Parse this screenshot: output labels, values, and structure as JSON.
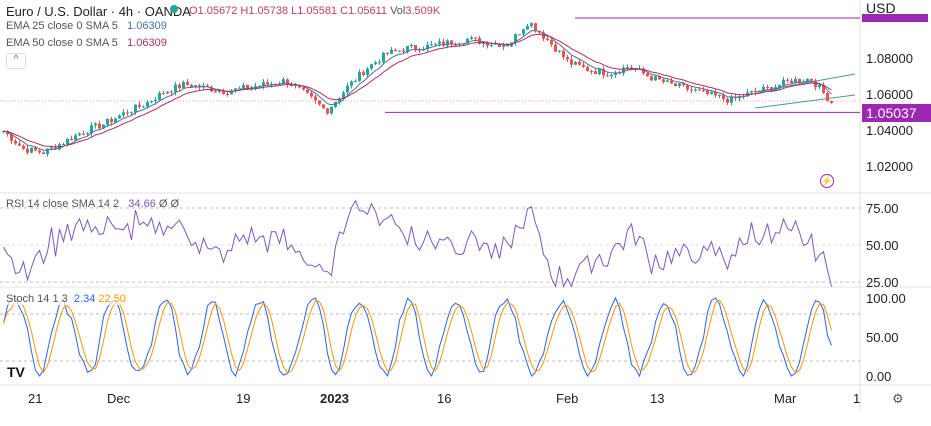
{
  "header": {
    "symbol": "Euro / U.S. Dollar · 4h · OANDA",
    "open": "O1.05672",
    "high": "H1.05738",
    "low": "L1.05581",
    "close": "C1.05611",
    "vol_label": "Vol",
    "vol": "3.509K"
  },
  "indicators": {
    "ema25_label": "EMA 25 close 0 SMA 5",
    "ema25_value": "1.06309",
    "ema50_label": "EMA 50 close 0 SMA 5",
    "ema50_value": "1.06309",
    "collapse": "^"
  },
  "price_axis": {
    "currency": "USD",
    "ticks": [
      "1.08000",
      "1.06000",
      "1.04000",
      "1.02000"
    ],
    "current_price": "1.05037"
  },
  "rsi": {
    "label": "RSI 14 close SMA 14 2",
    "value": "34.66",
    "extra": "Ø Ø",
    "ticks": [
      "75.00",
      "50.00",
      "25.00"
    ]
  },
  "stoch": {
    "label": "Stoch 14 1 3",
    "k": "2.34",
    "d": "22.50",
    "ticks": [
      "100.00",
      "50.00",
      "0.00"
    ]
  },
  "time_axis": [
    "21",
    "Dec",
    "19",
    "2023",
    "16",
    "Feb",
    "13",
    "Mar",
    "1"
  ],
  "colors": {
    "up": "#26a69a",
    "down": "#ef5350",
    "accent": "#9c27b0",
    "ema25": "#4a6fa5",
    "ema50": "#b03060"
  },
  "chart_data": {
    "type": "candlestick",
    "price_keypoints": [
      1.04,
      1.03,
      1.028,
      1.034,
      1.04,
      1.044,
      1.05,
      1.055,
      1.062,
      1.066,
      1.064,
      1.062,
      1.064,
      1.066,
      1.068,
      1.06,
      1.051,
      1.064,
      1.075,
      1.083,
      1.086,
      1.087,
      1.089,
      1.091,
      1.089,
      1.088,
      1.101,
      1.09,
      1.078,
      1.074,
      1.072,
      1.076,
      1.07,
      1.066,
      1.063,
      1.06,
      1.057,
      1.061,
      1.064,
      1.068,
      1.069,
      1.056
    ],
    "resistance": 1.1028,
    "support": 1.05037
  }
}
